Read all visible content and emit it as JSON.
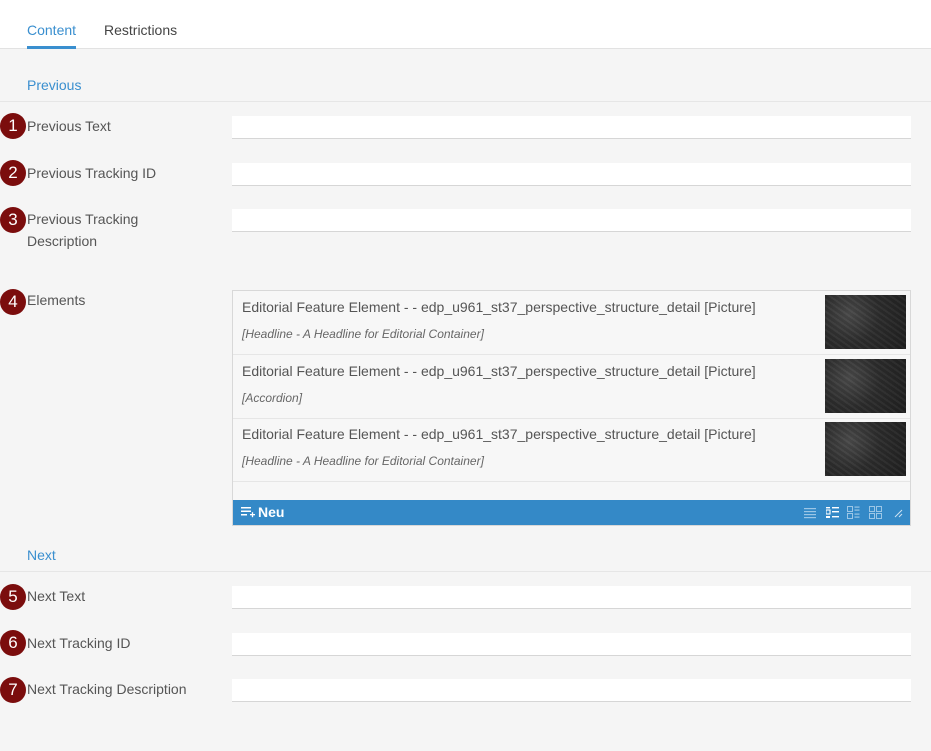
{
  "tabs": [
    {
      "label": "Content",
      "active": true
    },
    {
      "label": "Restrictions",
      "active": false
    }
  ],
  "sections": {
    "previous": {
      "title": "Previous"
    },
    "next": {
      "title": "Next"
    }
  },
  "badges": [
    "1",
    "2",
    "3",
    "4",
    "5",
    "6",
    "7"
  ],
  "fields": {
    "previous_text": {
      "label": "Previous Text",
      "value": ""
    },
    "previous_tracking_id": {
      "label": "Previous Tracking ID",
      "value": ""
    },
    "previous_tracking_description": {
      "label": "Previous Tracking Description",
      "value": ""
    },
    "elements": {
      "label": "Elements"
    },
    "next_text": {
      "label": "Next Text",
      "value": ""
    },
    "next_tracking_id": {
      "label": "Next Tracking ID",
      "value": ""
    },
    "next_tracking_description": {
      "label": "Next Tracking Description",
      "value": ""
    }
  },
  "elements": {
    "items": [
      {
        "title": "Editorial Feature Element - - edp_u961_st37_perspective_structure_detail [Picture]",
        "subtitle": "[Headline - A Headline for Editorial Container]",
        "thumbnail": "dark-texture-image"
      },
      {
        "title": "Editorial Feature Element - - edp_u961_st37_perspective_structure_detail [Picture]",
        "subtitle": "[Accordion]",
        "thumbnail": "dark-texture-image"
      },
      {
        "title": "Editorial Feature Element - - edp_u961_st37_perspective_structure_detail [Picture]",
        "subtitle": "[Headline - A Headline for Editorial Container]",
        "thumbnail": "dark-texture-image"
      }
    ],
    "toolbar": {
      "new_label": "Neu",
      "icons": [
        "new-list-icon",
        "list-view-icon",
        "detail-view-icon",
        "tile-view-icon",
        "grid-view-icon",
        "resize-handle-icon"
      ]
    }
  },
  "colors": {
    "accent": "#3a8fcf",
    "toolbar": "#3489c7",
    "badge": "#7b0d0d",
    "background": "#f5f5f5"
  }
}
